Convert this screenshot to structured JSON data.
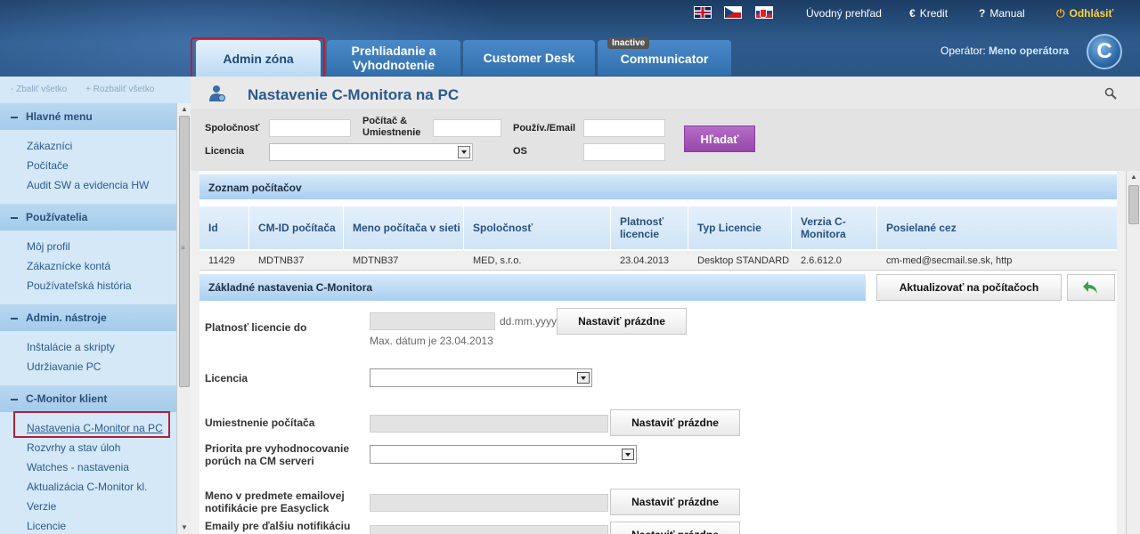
{
  "app": {
    "top_links": {
      "overview": "Úvodný prehľad",
      "credit": "Kredit",
      "manual": "Manual",
      "logout": "Odhlásiť"
    },
    "tabs": {
      "admin": "Admin zóna",
      "review": "Prehliadanie a Vyhodnotenie",
      "desk": "Customer Desk",
      "communicator": "Communicator",
      "communicator_badge": "Inactive"
    },
    "operator_label": "Operátor:",
    "operator_name": "Meno operátora",
    "logo_letter": "C"
  },
  "sidebar": {
    "collapse_all": "- Zbaliť všetko",
    "expand_all": "+ Rozbaliť všetko",
    "groups": [
      {
        "title": "Hlavné menu",
        "items": [
          "Zákazníci",
          "Počítače",
          "Audit SW a evidencia HW"
        ]
      },
      {
        "title": "Používatelia",
        "items": [
          "Môj profil",
          "Zákaznícke kontá",
          "Používateľská história"
        ]
      },
      {
        "title": "Admin. nástroje",
        "items": [
          "Inštalácie a skripty",
          "Udržiavanie PC"
        ]
      },
      {
        "title": "C-Monitor klient",
        "items": [
          "Nastavenia C-Monitor na PC",
          "Rozvrhy a stav úloh",
          "Watches - nastavenia",
          "Aktualizácia C-Monitor kl.",
          "Verzie",
          "Licencie"
        ]
      }
    ]
  },
  "page": {
    "title": "Nastavenie C-Monitora na PC",
    "filter": {
      "company": "Spoločnosť",
      "computer": "Počítač & Umiestnenie",
      "user": "Použív./Email",
      "license": "Licencia",
      "os": "OS",
      "search_button": "Hľadať"
    },
    "list_title": "Zoznam počítačov",
    "columns": [
      "Id",
      "CM-ID počítača",
      "Meno počítača v sieti",
      "Spoločnosť",
      "Platnosť licencie",
      "Typ Licencie",
      "Verzia C-Monitora",
      "Posielané cez"
    ],
    "row": [
      "11429",
      "MDTNB37",
      "MDTNB37",
      "MED, s.r.o.",
      "23.04.2013",
      "Desktop STANDARD",
      "2.6.612.0",
      "cm-med@secmail.se.sk, http"
    ],
    "settings_title": "Základné nastavenia C-Monitora",
    "update_button": "Aktualizovať na počítačoch",
    "fields": {
      "validity_label": "Platnosť licencie do",
      "date_format": "dd.mm.yyyy",
      "max_date": "Max. dátum je 23.04.2013",
      "license_label": "Licencia",
      "location_label": "Umiestnenie počítača",
      "priority_label": "Priorita pre vyhodnocovanie porúch na CM serveri",
      "subject_label": "Meno v predmete emailovej notifikácie pre Easyclick",
      "emails_label": "Emaily pre ďalšiu notifikáciu",
      "set_empty": "Nastaviť prázdne"
    }
  },
  "colors": {
    "header": "#2e5b8c",
    "highlight": "#b0203a",
    "search_button": "#9648aa"
  }
}
